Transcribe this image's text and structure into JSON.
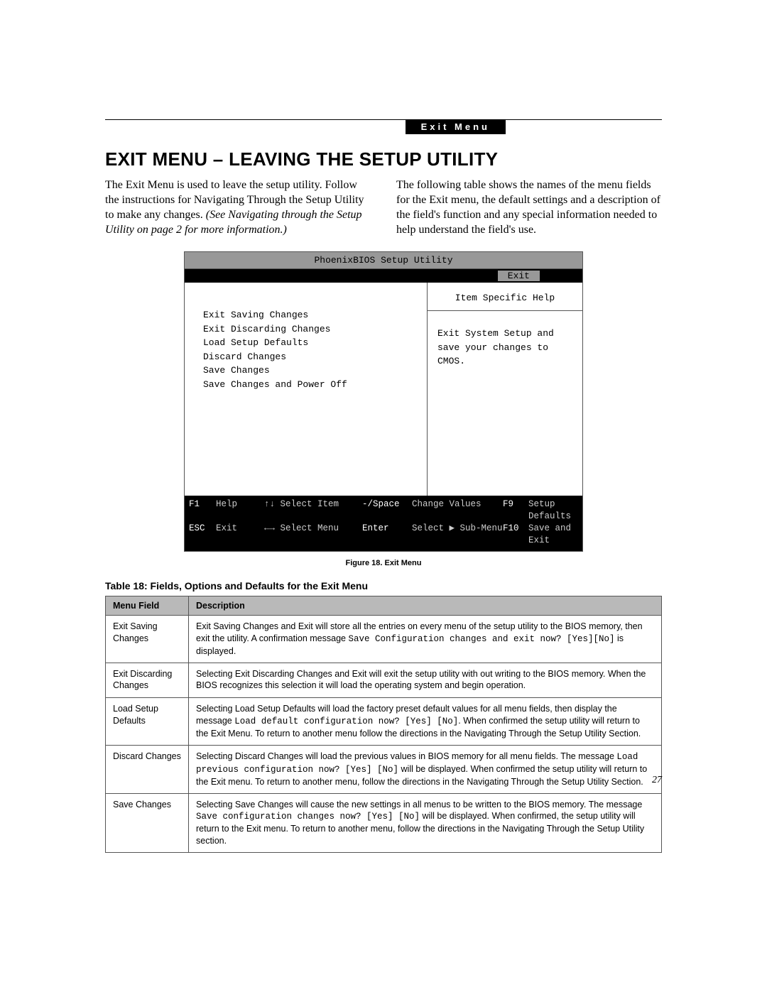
{
  "header": {
    "tab": "Exit Menu"
  },
  "title": "EXIT MENU – LEAVING THE SETUP UTILITY",
  "intro": {
    "left_a": "The Exit Menu is used to leave the setup utility. Follow the instructions for Navigating Through the Setup Utility to make any changes. ",
    "left_b": "(See Navigating through the Setup Utility on page 2 for more information.)",
    "right": "The following table shows the names of the menu fields for the Exit menu, the default settings and a description of the field's function and any special information needed to help understand the field's use."
  },
  "bios": {
    "titlebar": "PhoenixBIOS Setup Utility",
    "tab": "Exit",
    "menu_items": [
      "Exit Saving Changes",
      "Exit Discarding Changes",
      "Load Setup Defaults",
      "Discard Changes",
      "Save Changes",
      "Save Changes and Power Off"
    ],
    "help_title": "Item Specific Help",
    "help_body": "Exit System Setup and save your changes to CMOS.",
    "footer": {
      "r1": {
        "k1": "F1",
        "l1": "Help",
        "k2": "↑↓",
        "l2": "Select Item",
        "k3": "-/Space",
        "l3": "Change Values",
        "k4": "F9",
        "l4": "Setup Defaults"
      },
      "r2": {
        "k1": "ESC",
        "l1": "Exit",
        "k2": "←→",
        "l2": "Select Menu",
        "k3": "Enter",
        "l3": "Select ▶ Sub-Menu",
        "k4": "F10",
        "l4": "Save and Exit"
      }
    }
  },
  "figure_caption": "Figure 18.  Exit Menu",
  "table_caption": "Table 18: Fields, Options and Defaults for the Exit Menu",
  "table": {
    "headers": {
      "field": "Menu Field",
      "desc": "Description"
    },
    "rows": [
      {
        "field": "Exit Saving Changes",
        "desc_a": "Exit Saving Changes and Exit will store all the entries on every menu of the setup utility to the BIOS memory, then exit the utility. A confirmation message ",
        "code_a": "Save Configuration changes and exit now? [Yes][No]",
        "desc_b": " is displayed."
      },
      {
        "field": "Exit Discarding Changes",
        "desc_a": "Selecting Exit Discarding Changes and Exit will exit the setup utility with out writing to the BIOS memory. When the BIOS recognizes this selection it will load the operating system and begin operation.",
        "code_a": "",
        "desc_b": ""
      },
      {
        "field": "Load Setup Defaults",
        "desc_a": "Selecting Load Setup Defaults will load the factory preset default values for all menu fields, then display the message ",
        "code_a": "Load default configuration now? [Yes] [No]",
        "desc_b": ". When confirmed the setup utility will return to the Exit Menu. To return to another menu follow the directions in the Navigating Through the Setup Utility Section."
      },
      {
        "field": "Discard Changes",
        "desc_a": "Selecting Discard Changes will load the previous values in BIOS memory for all menu fields. The message ",
        "code_a": "Load previous configuration now? [Yes] [No]",
        "desc_b": " will be displayed. When confirmed the setup utility will return to the Exit menu. To return to another menu, follow the directions in the Navigating Through the Setup Utility Section."
      },
      {
        "field": "Save Changes",
        "desc_a": "Selecting Save Changes will cause the new settings in all menus to be written to the BIOS memory. The message ",
        "code_a": "Save configuration changes now? [Yes] [No]",
        "desc_b": " will be displayed. When confirmed, the setup utility will return to the Exit menu. To return to another menu, follow the directions in the Navigating Through the Setup Utility section."
      }
    ]
  },
  "page_number": "27"
}
